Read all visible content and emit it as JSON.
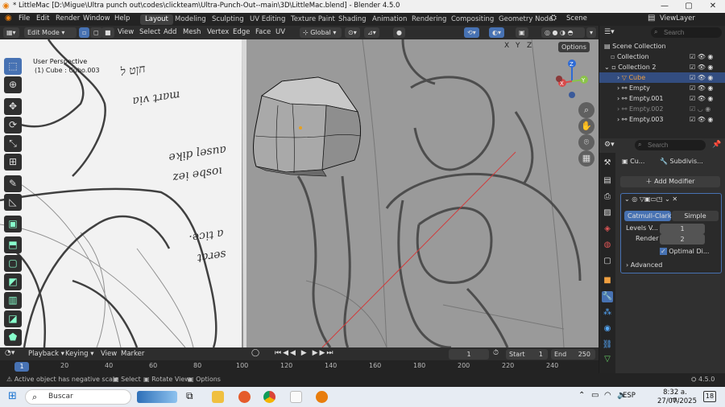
{
  "window": {
    "title": "* LittleMac [D:\\Migue\\Ultra punch out\\codes\\clickteam\\Ultra-Punch-Out--main\\3D\\LittleMac.blend] - Blender 4.5.0",
    "min": "—",
    "max": "▢",
    "close": "✕"
  },
  "menu": [
    "File",
    "Edit",
    "Render",
    "Window",
    "Help"
  ],
  "workspaces": [
    "Layout",
    "Modeling",
    "Sculpting",
    "UV Editing",
    "Texture Paint",
    "Shading",
    "Animation",
    "Rendering",
    "Compositing",
    "Geometry Node"
  ],
  "scene": "Scene",
  "viewlayer": "ViewLayer",
  "header": {
    "mode": "Edit Mode",
    "items": [
      "View",
      "Select",
      "Add",
      "Mesh",
      "Vertex",
      "Edge",
      "Face",
      "UV"
    ],
    "orientation": "Global",
    "options": "Options"
  },
  "viewport": {
    "title": "User Perspective",
    "subtitle": "(1) Cube : Cubo.003",
    "axes": [
      "X",
      "Y",
      "Z"
    ],
    "gizmo": {
      "x": "X",
      "y": "Y",
      "z": "Z"
    }
  },
  "outliner": {
    "search_placeholder": "Search",
    "root": "Scene Collection",
    "rows": [
      {
        "label": "Collection"
      },
      {
        "label": "Collection 2"
      },
      {
        "label": "Cube",
        "selected": true
      },
      {
        "label": "Empty"
      },
      {
        "label": "Empty.001"
      },
      {
        "label": "Empty.002"
      },
      {
        "label": "Empty.003"
      }
    ]
  },
  "properties": {
    "search_placeholder": "Search",
    "object_name": "Cu...",
    "modifier_short": "Subdivis...",
    "add_modifier": "Add Modifier",
    "catmull": "Catmull-Clark",
    "simple": "Simple",
    "levels_label": "Levels V...",
    "levels_value": "1",
    "render_label": "Render",
    "render_value": "2",
    "optimal": "Optimal Di...",
    "advanced": "Advanced"
  },
  "timeline": {
    "playback": "Playback",
    "keying": "Keying",
    "view": "View",
    "marker": "Marker",
    "current": "1",
    "start_label": "Start",
    "start": "1",
    "end_label": "End",
    "end": "250",
    "current_marker": "1",
    "ticks": [
      "20",
      "40",
      "60",
      "80",
      "100",
      "120",
      "140",
      "160",
      "180",
      "200",
      "220",
      "240"
    ]
  },
  "status": {
    "warning": "Active object has negative scale",
    "select": "Select",
    "rotate": "Rotate View",
    "options": "Options",
    "version": "4.5.0"
  },
  "taskbar": {
    "search": "Buscar",
    "lang": "ESP",
    "time": "8:32 a. m.",
    "date": "27/07/2025",
    "notif": "18"
  }
}
